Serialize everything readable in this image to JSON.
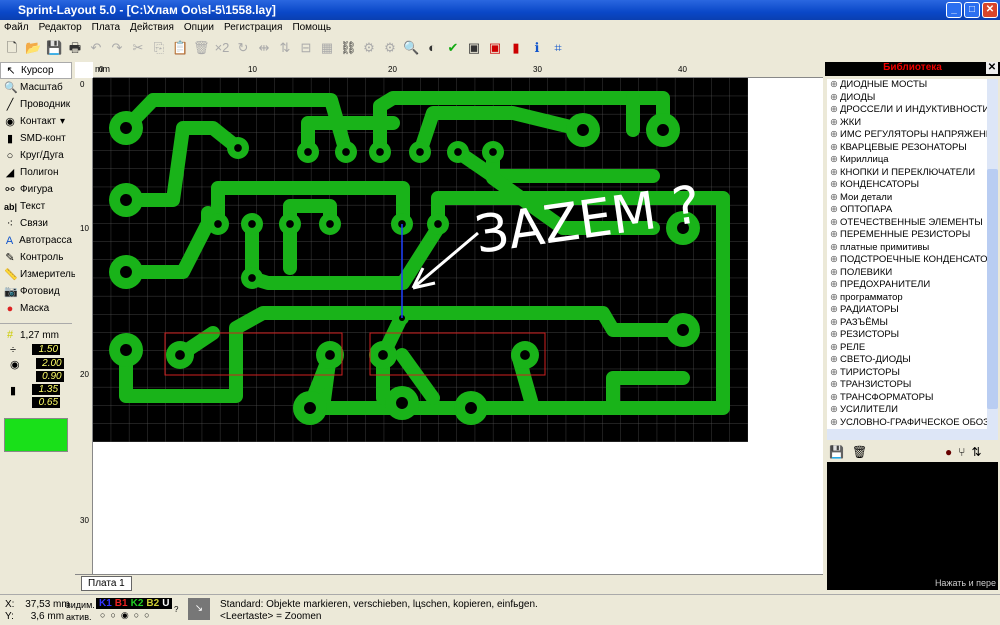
{
  "window": {
    "title": "Sprint-Layout 5.0 - [C:\\Хлам Oo\\sl-5\\1558.lay]"
  },
  "menu": [
    "Файл",
    "Редактор",
    "Плата",
    "Действия",
    "Опции",
    "Регистрация",
    "Помощь"
  ],
  "tools": [
    "Курсор",
    "Масштаб",
    "Проводник",
    "Контакт",
    "SMD-конт",
    "Круг/Дуга",
    "Полигон",
    "Фигура",
    "Текст",
    "Связи",
    "Автотрасса",
    "Контроль",
    "Измеритель",
    "Фотовид",
    "Маска"
  ],
  "grid": "1,27 mm",
  "values": {
    "track": "1.50",
    "pad_outer": "2.00",
    "pad_inner": "0.90",
    "smd_w": "1.35",
    "smd_h": "0.65"
  },
  "ruler": {
    "unit": "mm",
    "top": [
      "0",
      "10",
      "20",
      "30",
      "40"
    ],
    "left": [
      "0",
      "10",
      "20",
      "30"
    ]
  },
  "annotation": "ЗAZEM ?",
  "tab": "Плата 1",
  "library": {
    "title": "Библиотека",
    "items": [
      "ДИОДНЫЕ МОСТЫ",
      "ДИОДЫ",
      "ДРОССЕЛИ И ИНДУКТИВНОСТИ",
      "ЖКИ",
      "ИМС РЕГУЛЯТОРЫ НАПРЯЖЕНИЯ",
      "КВАРЦЕВЫЕ РЕЗОНАТОРЫ",
      "Кириллица",
      "КНОПКИ И ПЕРЕКЛЮЧАТЕЛИ",
      "КОНДЕНСАТОРЫ",
      "Мои детали",
      "ОПТОПАРА",
      "ОТЕЧЕСТВЕННЫЕ ЭЛЕМЕНТЫ",
      "ПЕРЕМЕННЫЕ РЕЗИСТОРЫ",
      "платные примитивы",
      "ПОДСТРОЕЧНЫЕ КОНДЕНСАТОР",
      "ПОЛЕВИКИ",
      "ПРЕДОХРАНИТЕЛИ",
      "программатор",
      "РАДИАТОРЫ",
      "РАЗЪЁМЫ",
      "РЕЗИСТОРЫ",
      "РЕЛЕ",
      "СВЕТО-ДИОДЫ",
      "ТИРИСТОРЫ",
      "ТРАНЗИСТОРЫ",
      "ТРАНСФОРМАТОРЫ",
      "УСИЛИТЕЛИ",
      "УСЛОВНО-ГРАФИЧЕСКОЕ ОБОЗН"
    ],
    "preview_hint": "Нажать и пере"
  },
  "status": {
    "x_label": "X:",
    "x": "37,53 mm",
    "y_label": "Y:",
    "y": "3,6 mm",
    "visible": "видим.",
    "active": "актив.",
    "layers": [
      "K1",
      "B1",
      "K2",
      "B2",
      "U"
    ],
    "help": "?",
    "msg1": "Standard: Objekte markieren, verschieben, lцschen, kopieren, einfьgen.",
    "msg2": "<Leertaste> = Zoomen"
  },
  "colors": {
    "copper": "#19b319",
    "board": "#000000",
    "silk": "#d02020"
  }
}
